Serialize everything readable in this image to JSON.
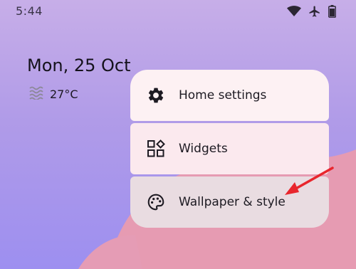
{
  "status_bar": {
    "time": "5:44",
    "icons": [
      "wifi-icon",
      "airplane-icon",
      "battery-icon"
    ]
  },
  "home": {
    "date": "Mon, 25 Oct",
    "weather": {
      "icon": "haze-icon",
      "temperature": "27°C"
    }
  },
  "menu": {
    "items": [
      {
        "label": "Home settings",
        "icon": "gear-icon"
      },
      {
        "label": "Widgets",
        "icon": "widgets-icon"
      },
      {
        "label": "Wallpaper & style",
        "icon": "palette-icon"
      }
    ]
  },
  "annotation": {
    "arrow_color": "#e8262d"
  }
}
